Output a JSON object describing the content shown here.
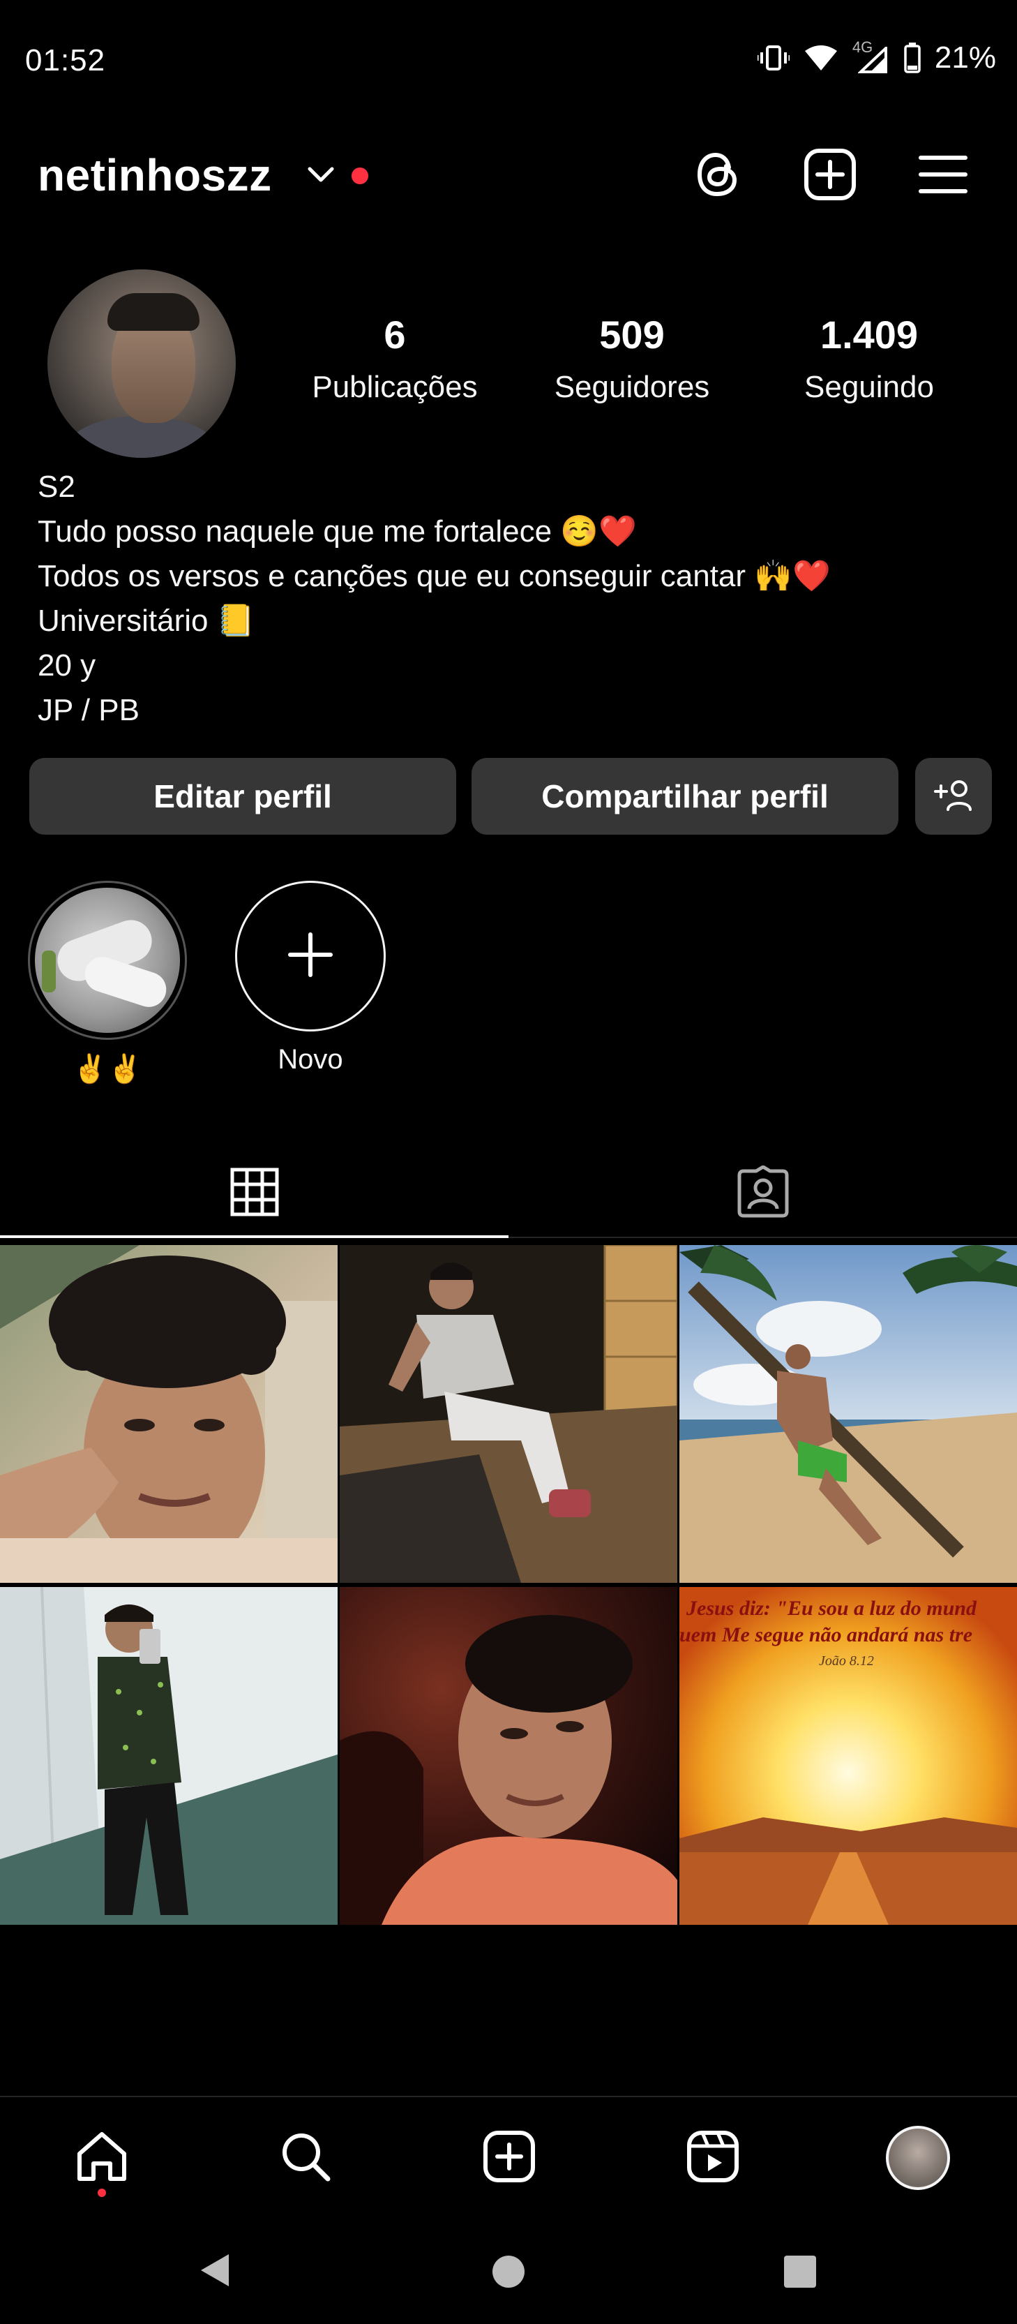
{
  "status_bar": {
    "time": "01:52",
    "network": "4G",
    "battery": "21%"
  },
  "header": {
    "username": "netinhoszz",
    "icons": [
      "chevron-down-icon",
      "threads-icon",
      "create-icon",
      "menu-icon"
    ]
  },
  "profile": {
    "stats": [
      {
        "value": "6",
        "label": "Publicações"
      },
      {
        "value": "509",
        "label": "Seguidores"
      },
      {
        "value": "1.409",
        "label": "Seguindo"
      }
    ],
    "bio": [
      "S2",
      "Tudo posso naquele que me fortalece ☺️❤️",
      "Todos os versos e canções que eu conseguir cantar 🙌❤️",
      "Universitário 📒",
      "20 y",
      "JP / PB"
    ]
  },
  "actions": {
    "edit": "Editar perfil",
    "share": "Compartilhar perfil"
  },
  "highlights": [
    {
      "label": "✌️✌️"
    },
    {
      "label": "Novo"
    }
  ],
  "tabs": [
    "grid-icon",
    "tagged-icon"
  ],
  "posts": [
    {
      "id": 1,
      "name": "post-curly-hair-selfie"
    },
    {
      "id": 2,
      "name": "post-crouching-pose"
    },
    {
      "id": 3,
      "name": "post-beach-palm-tree"
    },
    {
      "id": 4,
      "name": "post-mirror-selfie"
    },
    {
      "id": 5,
      "name": "post-portrait-looking-up"
    },
    {
      "id": 6,
      "name": "post-sunset-verse"
    }
  ],
  "verse_post": {
    "line1": "Jesus diz: \"Eu sou a luz do mund",
    "line2": "uem Me segue não andará nas tre",
    "ref": "João 8.12"
  },
  "bottom_nav": [
    "home-icon",
    "search-icon",
    "create-icon",
    "reels-icon",
    "profile-avatar"
  ]
}
